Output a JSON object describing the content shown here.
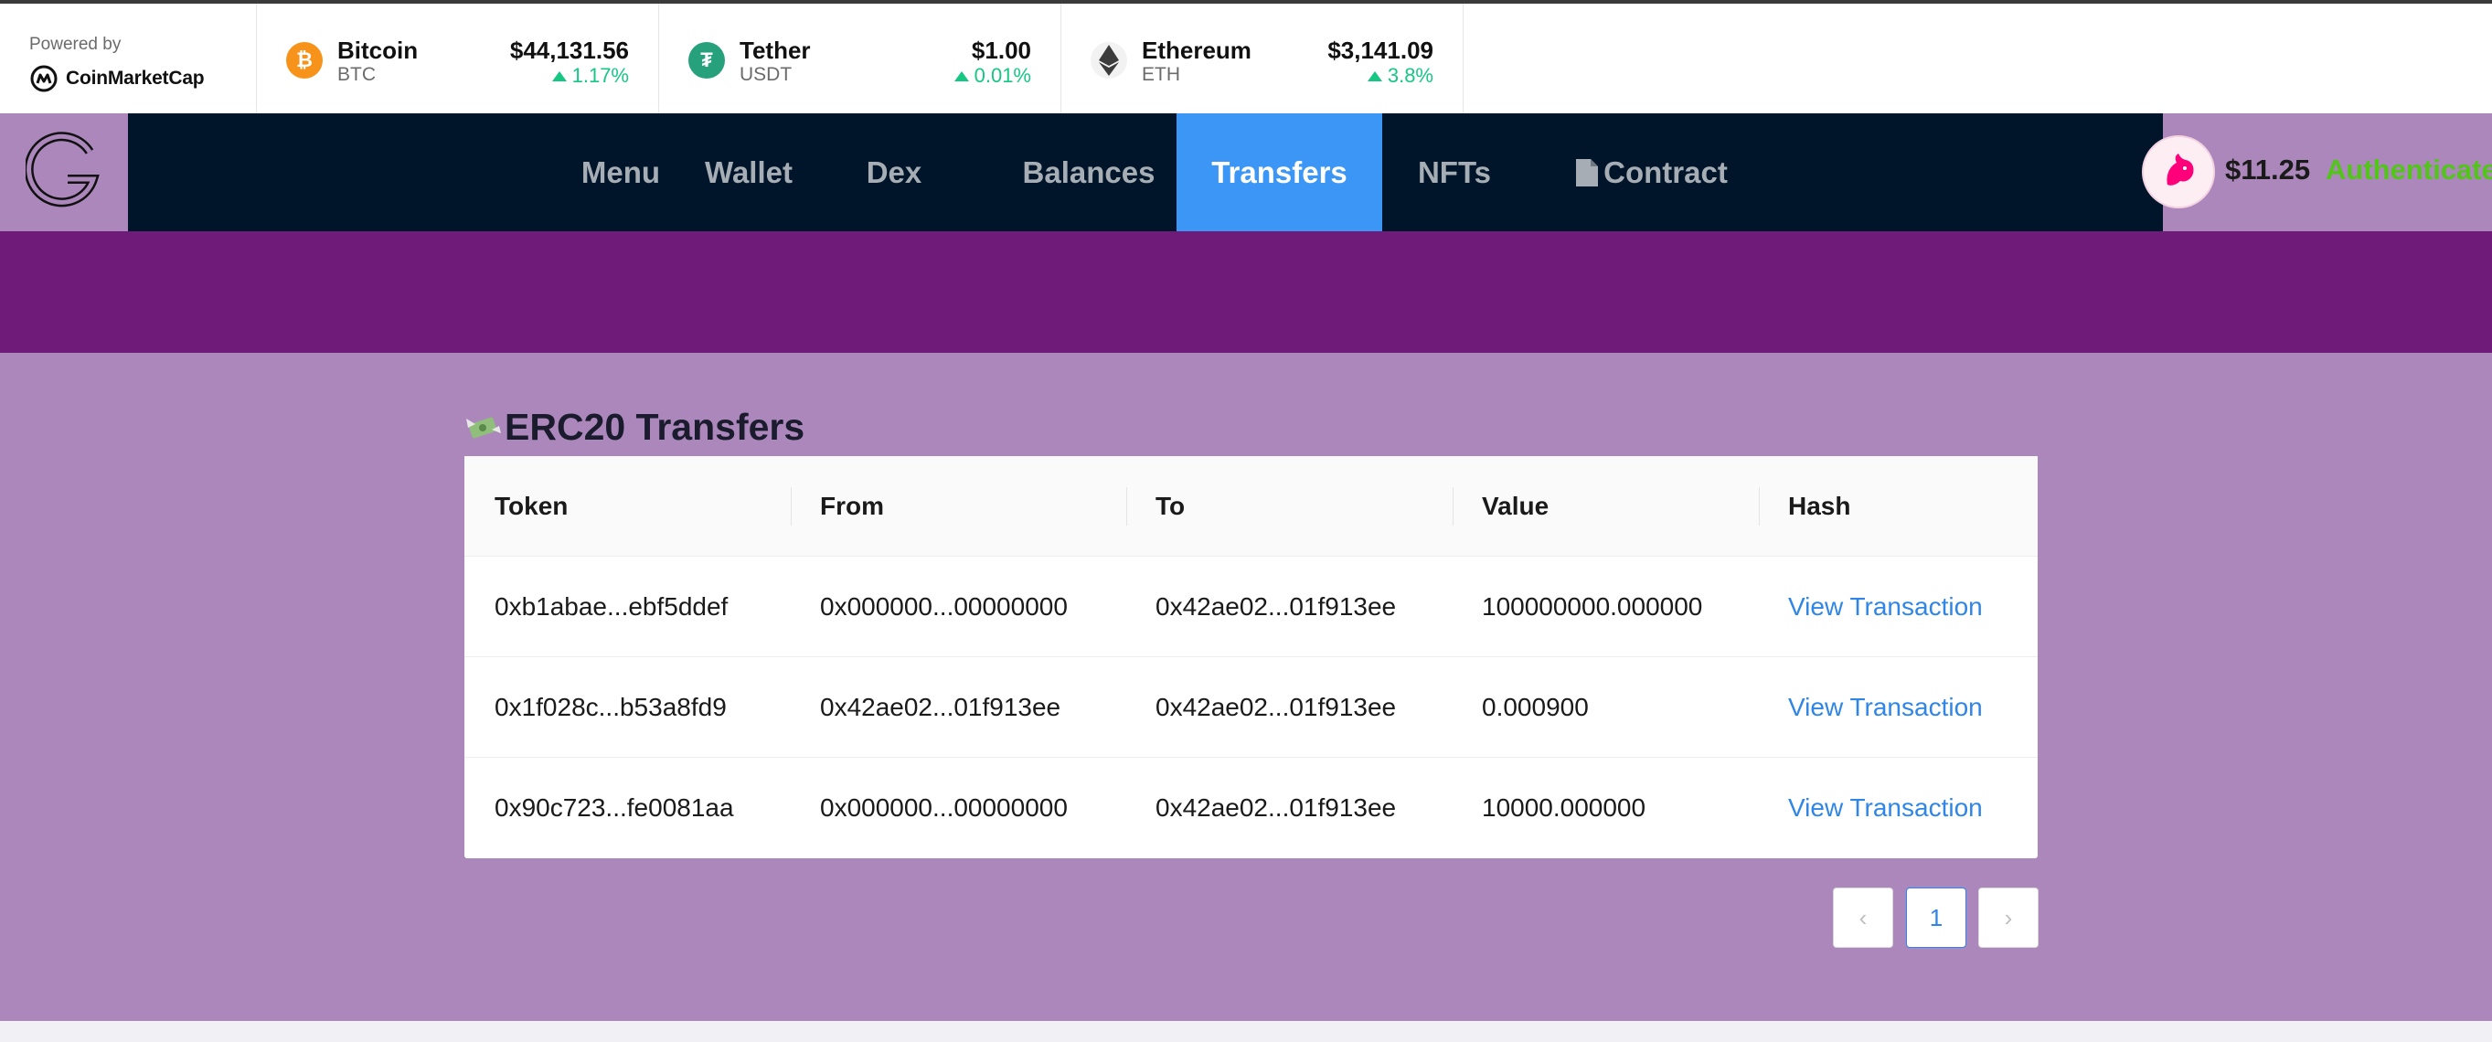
{
  "ticker": {
    "powered_by": "Powered by",
    "brand": "CoinMarketCap",
    "coins": [
      {
        "name": "Bitcoin",
        "symbol": "BTC",
        "price": "$44,131.56",
        "change": "1.17%",
        "icon": "bitcoin-icon",
        "color": "#f7931a"
      },
      {
        "name": "Tether",
        "symbol": "USDT",
        "price": "$1.00",
        "change": "0.01%",
        "icon": "tether-icon",
        "color": "#26a17b"
      },
      {
        "name": "Ethereum",
        "symbol": "ETH",
        "price": "$3,141.09",
        "change": "3.8%",
        "icon": "ethereum-icon",
        "color": "#3c3c3d"
      }
    ]
  },
  "header": {
    "nav": [
      "Menu",
      "Wallet",
      "Dex",
      "Balances",
      "Transfers",
      "NFTs",
      "Contract"
    ],
    "active": "Transfers",
    "balance": "$11.25",
    "auth_label": "Authenticate"
  },
  "transfers": {
    "title": "ERC20 Transfers",
    "columns": [
      "Token",
      "From",
      "To",
      "Value",
      "Hash"
    ],
    "rows": [
      {
        "token": "0xb1abae...ebf5ddef",
        "from": "0x000000...00000000",
        "to": "0x42ae02...01f913ee",
        "value": "100000000.000000",
        "hash": "View Transaction"
      },
      {
        "token": "0x1f028c...b53a8fd9",
        "from": "0x42ae02...01f913ee",
        "to": "0x42ae02...01f913ee",
        "value": "0.000900",
        "hash": "View Transaction"
      },
      {
        "token": "0x90c723...fe0081aa",
        "from": "0x000000...00000000",
        "to": "0x42ae02...01f913ee",
        "value": "10000.000000",
        "hash": "View Transaction"
      }
    ],
    "pagination": {
      "prev": "‹",
      "current": "1",
      "next": "›"
    }
  },
  "colors": {
    "accent": "#3b96f5",
    "nav_bg": "#001529",
    "band": "#6e1b7a",
    "content_bg": "#ab87bb",
    "up": "#16c784",
    "auth": "#52c41a"
  }
}
